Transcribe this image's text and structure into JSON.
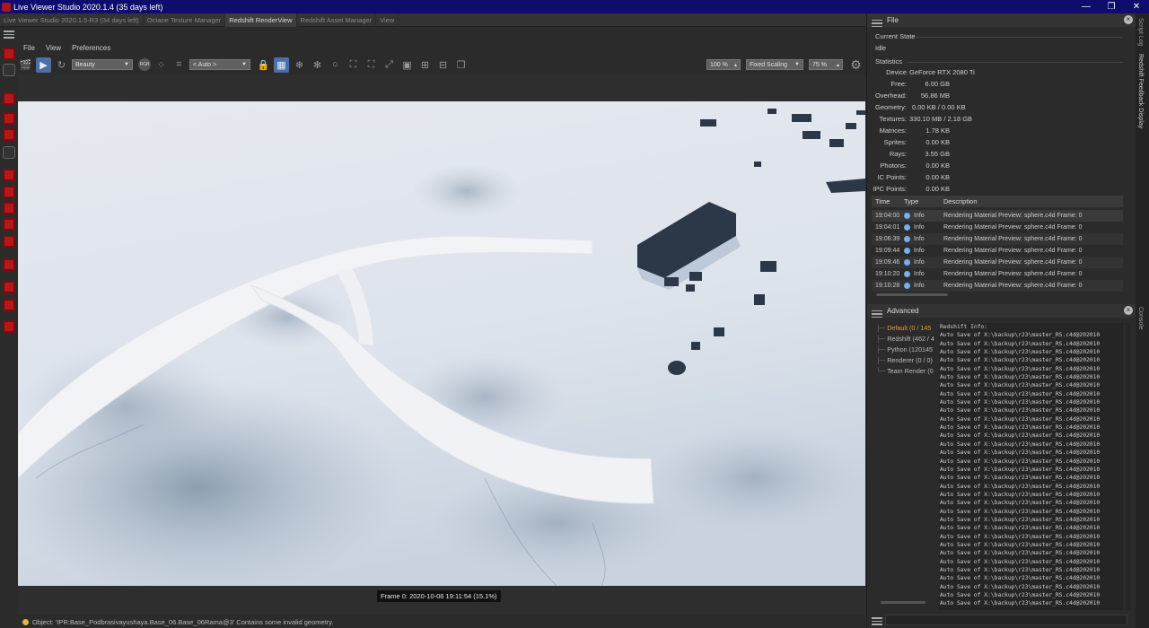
{
  "window": {
    "title": "Live Viewer Studio 2020.1.4 (35 days left)",
    "controls": [
      "—",
      "❐",
      "✕"
    ]
  },
  "tabs": [
    {
      "label": "Live Viewer Studio 2020.1.5-R3 (34 days left)",
      "active": false
    },
    {
      "label": "Octane Texture Manager",
      "active": false
    },
    {
      "label": "Redshift RenderView",
      "active": true
    },
    {
      "label": "Redshift Asset Manager",
      "active": false
    },
    {
      "label": "View",
      "active": false
    }
  ],
  "menu": [
    "File",
    "View",
    "Preferences"
  ],
  "toolbar": {
    "aov_select": "Beauty",
    "rgb_label": "RGB",
    "camera_select": "< Auto >",
    "zoom": "100 %",
    "scaling": "Fixed Scaling",
    "scale_pct": "75 %"
  },
  "viewport": {
    "frame_info": "Frame  0:  2020-10-06  19:11:54  (15.1%)"
  },
  "status": {
    "message": "Object: 'IPR:Base_Podbrasivayushaya.Base_06.Base_06Rama@3' Contains some invalid geometry."
  },
  "right_panel": {
    "file_header": "File",
    "current_state_label": "Current State",
    "state": "Idle",
    "statistics_label": "Statistics",
    "stats": [
      {
        "label": "Device",
        "value": "GeForce RTX 2080 Ti"
      },
      {
        "label": "Free:",
        "value": "6.00 GB"
      },
      {
        "label": "Overhead:",
        "value": "56.86 MB"
      },
      {
        "label": "Geometry:",
        "value": "0.00 KB / 0.00 KB"
      },
      {
        "label": "Textures:",
        "value": "330.10 MB / 2.18 GB"
      },
      {
        "label": "Matrices:",
        "value": "1.78 KB"
      },
      {
        "label": "Sprites:",
        "value": "0.00 KB"
      },
      {
        "label": "Rays:",
        "value": "3.55 GB"
      },
      {
        "label": "Photons:",
        "value": "0.00 KB"
      },
      {
        "label": "IC Points:",
        "value": "0.00 KB"
      },
      {
        "label": "IPC Points:",
        "value": "0.00 KB"
      }
    ],
    "log_columns": [
      "Time",
      "Type",
      "Description"
    ],
    "log_rows": [
      {
        "time": "19:04:00",
        "type": "Info",
        "desc": "Rendering Material Preview: sphere.c4d Frame: 0"
      },
      {
        "time": "19:04:01",
        "type": "Info",
        "desc": "Rendering Material Preview: sphere.c4d Frame: 0"
      },
      {
        "time": "19:06:39",
        "type": "Info",
        "desc": "Rendering Material Preview: sphere.c4d Frame: 0"
      },
      {
        "time": "19:09:44",
        "type": "Info",
        "desc": "Rendering Material Preview: sphere.c4d Frame: 0"
      },
      {
        "time": "19:09:46",
        "type": "Info",
        "desc": "Rendering Material Preview: sphere.c4d Frame: 0"
      },
      {
        "time": "19:10:20",
        "type": "Info",
        "desc": "Rendering Material Preview: sphere.c4d Frame: 0"
      },
      {
        "time": "19:10:28",
        "type": "Info",
        "desc": "Rendering Material Preview: sphere.c4d Frame: 0"
      }
    ],
    "advanced_header": "Advanced",
    "tree_items": [
      {
        "label": "Default (0 / 145",
        "active": true
      },
      {
        "label": "Redshift (462 / 4",
        "active": false
      },
      {
        "label": "Python (120145",
        "active": false
      },
      {
        "label": "Renderer (0 / 0)",
        "active": false
      },
      {
        "label": "Team Render  (0",
        "active": false
      }
    ],
    "console_lines": [
      "Redshift Info:",
      "Auto Save of X:\\backup\\r23\\master_RS.c4d@202010",
      "Auto Save of X:\\backup\\r23\\master_RS.c4d@202010",
      "Auto Save of X:\\backup\\r23\\master_RS.c4d@202010",
      "Auto Save of X:\\backup\\r23\\master_RS.c4d@202010",
      "Auto Save of X:\\backup\\r23\\master_RS.c4d@202010",
      "Auto Save of X:\\backup\\r23\\master_RS.c4d@202010",
      "Auto Save of X:\\backup\\r23\\master_RS.c4d@202010",
      "Auto Save of X:\\backup\\r23\\master_RS.c4d@202010",
      "Auto Save of X:\\backup\\r23\\master_RS.c4d@202010",
      "Auto Save of X:\\backup\\r23\\master_RS.c4d@202010",
      "Auto Save of X:\\backup\\r23\\master_RS.c4d@202010",
      "Auto Save of X:\\backup\\r23\\master_RS.c4d@202010",
      "Auto Save of X:\\backup\\r23\\master_RS.c4d@202010",
      "Auto Save of X:\\backup\\r23\\master_RS.c4d@202010",
      "Auto Save of X:\\backup\\r23\\master_RS.c4d@202010",
      "Auto Save of X:\\backup\\r23\\master_RS.c4d@202010",
      "Auto Save of X:\\backup\\r23\\master_RS.c4d@202010",
      "Auto Save of X:\\backup\\r23\\master_RS.c4d@202010",
      "Auto Save of X:\\backup\\r23\\master_RS.c4d@202010",
      "Auto Save of X:\\backup\\r23\\master_RS.c4d@202010",
      "Auto Save of X:\\backup\\r23\\master_RS.c4d@202010",
      "Auto Save of X:\\backup\\r23\\master_RS.c4d@202010",
      "Auto Save of X:\\backup\\r23\\master_RS.c4d@202010",
      "Auto Save of X:\\backup\\r23\\master_RS.c4d@202010",
      "Auto Save of X:\\backup\\r23\\master_RS.c4d@202010",
      "Auto Save of X:\\backup\\r23\\master_RS.c4d@202010",
      "Auto Save of X:\\backup\\r23\\master_RS.c4d@202010",
      "Auto Save of X:\\backup\\r23\\master_RS.c4d@202010",
      "Auto Save of X:\\backup\\r23\\master_RS.c4d@202010",
      "Auto Save of X:\\backup\\r23\\master_RS.c4d@202010",
      "Auto Save of X:\\backup\\r23\\master_RS.c4d@202010",
      "Auto Save of X:\\backup\\r23\\master_RS.c4d@202010",
      "Auto Save of X:\\backup\\r23\\master_RS.c4d@202010",
      "Auto Save of X:\\backup\\r23\\master_RS.c4d@202010"
    ],
    "side_tabs": [
      "Script Log",
      "Redshift Feedback Display",
      "Console"
    ]
  },
  "colors": {
    "titlebar": "#0f0c6e",
    "accent_blue": "#4b6fa6",
    "red_icon": "#b5181a",
    "active_tree": "#e89a3c",
    "info_dot": "#7aaee6",
    "status_dot": "#e2b540"
  }
}
